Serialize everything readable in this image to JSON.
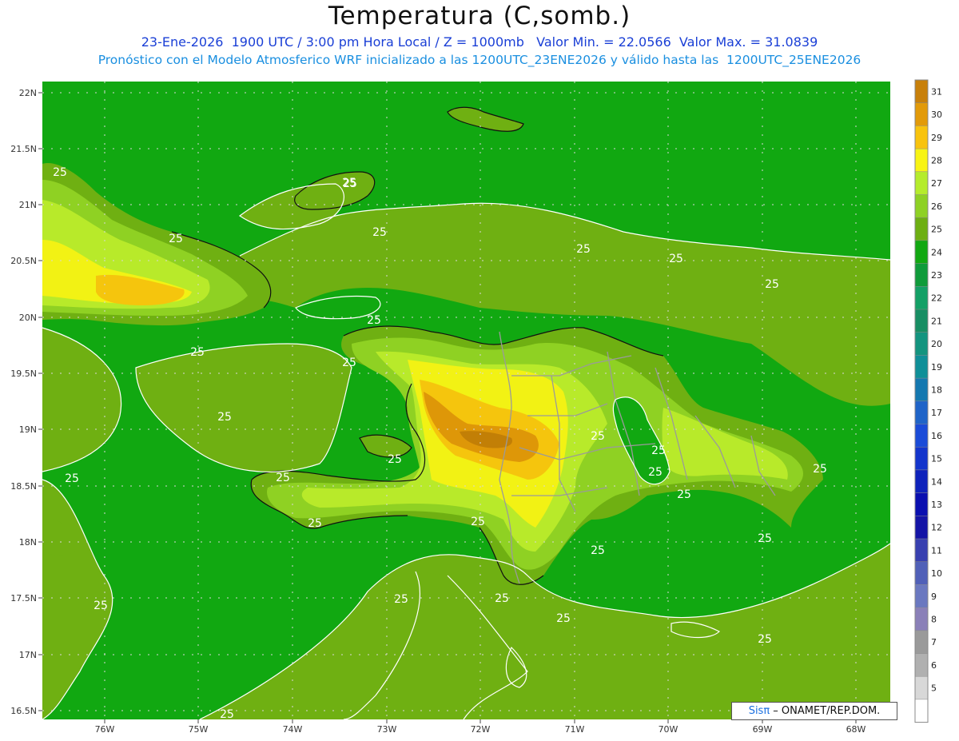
{
  "header": {
    "title": "Temperatura (C,somb.)",
    "line1": "23-Ene-2026  1900 UTC / 3:00 pm Hora Local / Z = 1000mb   Valor Min. = 22.0566  Valor Max. = 31.0839",
    "line2": "Pronóstico con el Modelo Atmosferico WRF inicializado a las 1200UTC_23ENE2026 y válido hasta las  1200UTC_25ENE2026"
  },
  "map": {
    "lat_labels": [
      "22N",
      "21.5N",
      "21N",
      "20.5N",
      "20N",
      "19.5N",
      "19N",
      "18.5N",
      "18N",
      "17.5N",
      "17N",
      "16.5N"
    ],
    "lon_labels": [
      "76W",
      "75W",
      "74W",
      "73W",
      "72W",
      "71W",
      "70W",
      "69W",
      "68W"
    ],
    "contour_label": "25",
    "contour_labels_count": 30,
    "colors": {
      "ocean": "#11a811",
      "land_25_26": "#6fb012",
      "land_26_27": "#8fd123",
      "land_27_28": "#b8ea2a",
      "land_28_29": "#f2f214",
      "land_29_30": "#f5c50d",
      "land_30_31": "#de9708",
      "land_31": "#c27f06",
      "coast": "#111111",
      "border": "#9a9a9a",
      "contour": "#ffffff"
    }
  },
  "colorbar": {
    "levels": [
      "31",
      "30",
      "29",
      "28",
      "27",
      "26",
      "25",
      "24",
      "23",
      "22",
      "21",
      "20",
      "19",
      "18",
      "17",
      "16",
      "15",
      "14",
      "13",
      "12",
      "11",
      "10",
      "9",
      "8",
      "7",
      "6",
      "5"
    ],
    "colors": [
      "#c8800a",
      "#e29a09",
      "#f8c30d",
      "#f8f414",
      "#b5ec2c",
      "#8ed124",
      "#6daf12",
      "#11a811",
      "#0f9b3a",
      "#13a066",
      "#178e63",
      "#13947f",
      "#0f8f98",
      "#1478b0",
      "#1f64c8",
      "#1a4bd8",
      "#1335cc",
      "#0e22bb",
      "#0a0fb0",
      "#1414a6",
      "#3840b0",
      "#5060b8",
      "#6a78c0",
      "#8a80b8",
      "#9a9a9a",
      "#b0b0b0",
      "#d8d8d8",
      "#ffffff"
    ]
  },
  "credit": {
    "logo": "Sisπ",
    "text": " – ONAMET/REP.DOM."
  }
}
